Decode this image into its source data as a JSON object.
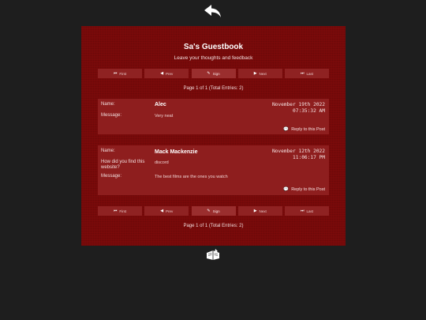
{
  "icons": {
    "back": "back-arrow-icon",
    "first": "first-icon",
    "prev": "prev-icon",
    "sign": "pen-icon",
    "next": "next-icon",
    "last": "last-icon",
    "reply": "comment-icon"
  },
  "guestbook": {
    "title": "Sa's Guestbook",
    "subtitle": "Leave your thoughts and feedback"
  },
  "nav": {
    "first": "First",
    "prev": "Prev",
    "sign": "Sign",
    "next": "Next",
    "last": "Last"
  },
  "pagination": {
    "info": "Page 1 of 1 (Total Entries: 2)"
  },
  "entries": [
    {
      "name_label": "Name:",
      "name": "Alec",
      "message_label": "Message:",
      "message": "Very neat",
      "date": "November 19th 2022",
      "time": "07:35:32 AM",
      "reply": "Reply to this Post"
    },
    {
      "name_label": "Name:",
      "name": "Mack Mackenzie",
      "question_label": "How did you find this website?",
      "question_answer": "discord",
      "message_label": "Message:",
      "message": "The best films are the ones you watch",
      "date": "November 12th 2022",
      "time": "11:06:17 PM",
      "reply": "Reply to this Post"
    }
  ],
  "colors": {
    "background": "#1e1e1e",
    "book": "#7a0a0a",
    "entry": "#8e1e1e",
    "button": "#8f2222"
  }
}
